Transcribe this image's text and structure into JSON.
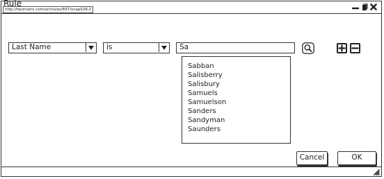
{
  "window": {
    "title": "Rule",
    "url_tooltip": "http://tworivers.com/archives/697/snap028-2",
    "controls": [
      "minimize-icon",
      "restore-icon",
      "close-icon"
    ]
  },
  "rule": {
    "field": {
      "value": "Last Name"
    },
    "operator": {
      "value": "is"
    },
    "query": {
      "value": "Sa"
    },
    "search_icon": "search-icon",
    "add_icon": "plus-icon",
    "remove_icon": "minus-icon"
  },
  "suggestions": [
    "Sabban",
    "Salisberry",
    "Salisbury",
    "Samuels",
    "Samuelson",
    "Sanders",
    "Sandyman",
    "Saunders"
  ],
  "buttons": {
    "cancel": "Cancel",
    "ok": "OK"
  }
}
